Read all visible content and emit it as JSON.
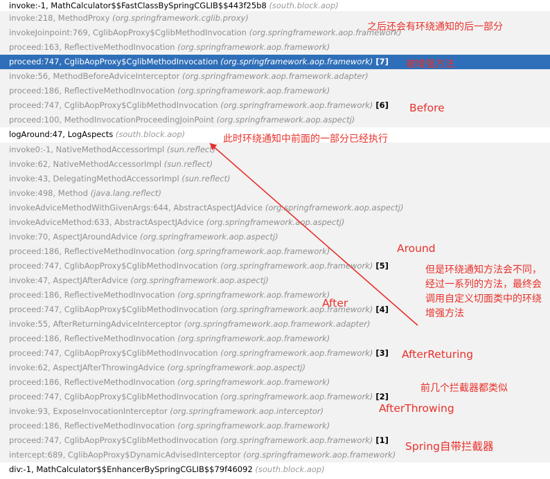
{
  "frames": [
    {
      "method": "invoke:-1, MathCalculator$$FastClassBySpringCGLIB$$443f25b8",
      "pkg": "(south.block.aop)",
      "kind": "user",
      "tag": ""
    },
    {
      "method": "invoke:218, MethodProxy",
      "pkg": "(org.springframework.cglib.proxy)",
      "kind": "lib",
      "tag": ""
    },
    {
      "method": "invokeJoinpoint:769, CglibAopProxy$CglibMethodInvocation",
      "pkg": "(org.springframework.aop.framework)",
      "kind": "lib",
      "tag": ""
    },
    {
      "method": "proceed:163, ReflectiveMethodInvocation",
      "pkg": "(org.springframework.aop.framework)",
      "kind": "lib",
      "tag": ""
    },
    {
      "method": "proceed:747, CglibAopProxy$CglibMethodInvocation",
      "pkg": "(org.springframework.aop.framework)",
      "kind": "sel",
      "tag": "[7]"
    },
    {
      "method": "invoke:56, MethodBeforeAdviceInterceptor",
      "pkg": "(org.springframework.aop.framework.adapter)",
      "kind": "lib",
      "tag": ""
    },
    {
      "method": "proceed:186, ReflectiveMethodInvocation",
      "pkg": "(org.springframework.aop.framework)",
      "kind": "lib",
      "tag": ""
    },
    {
      "method": "proceed:747, CglibAopProxy$CglibMethodInvocation",
      "pkg": "(org.springframework.aop.framework)",
      "kind": "lib",
      "tag": "[6]"
    },
    {
      "method": "proceed:100, MethodInvocationProceedingJoinPoint",
      "pkg": "(org.springframework.aop.aspectj)",
      "kind": "lib",
      "tag": ""
    },
    {
      "method": "logAround:47, LogAspects",
      "pkg": "(south.block.aop)",
      "kind": "user",
      "tag": ""
    },
    {
      "method": "invoke0:-1, NativeMethodAccessorImpl",
      "pkg": "(sun.reflect)",
      "kind": "lib",
      "tag": ""
    },
    {
      "method": "invoke:62, NativeMethodAccessorImpl",
      "pkg": "(sun.reflect)",
      "kind": "lib",
      "tag": ""
    },
    {
      "method": "invoke:43, DelegatingMethodAccessorImpl",
      "pkg": "(sun.reflect)",
      "kind": "lib",
      "tag": ""
    },
    {
      "method": "invoke:498, Method",
      "pkg": "(java.lang.reflect)",
      "kind": "lib",
      "tag": ""
    },
    {
      "method": "invokeAdviceMethodWithGivenArgs:644, AbstractAspectJAdvice",
      "pkg": "(org.springframework.aop.aspectj)",
      "kind": "lib",
      "tag": ""
    },
    {
      "method": "invokeAdviceMethod:633, AbstractAspectJAdvice",
      "pkg": "(org.springframework.aop.aspectj)",
      "kind": "lib",
      "tag": ""
    },
    {
      "method": "invoke:70, AspectJAroundAdvice",
      "pkg": "(org.springframework.aop.aspectj)",
      "kind": "lib",
      "tag": ""
    },
    {
      "method": "proceed:186, ReflectiveMethodInvocation",
      "pkg": "(org.springframework.aop.framework)",
      "kind": "lib",
      "tag": ""
    },
    {
      "method": "proceed:747, CglibAopProxy$CglibMethodInvocation",
      "pkg": "(org.springframework.aop.framework)",
      "kind": "lib",
      "tag": "[5]"
    },
    {
      "method": "invoke:47, AspectJAfterAdvice",
      "pkg": "(org.springframework.aop.aspectj)",
      "kind": "lib",
      "tag": ""
    },
    {
      "method": "proceed:186, ReflectiveMethodInvocation",
      "pkg": "(org.springframework.aop.framework)",
      "kind": "lib",
      "tag": ""
    },
    {
      "method": "proceed:747, CglibAopProxy$CglibMethodInvocation",
      "pkg": "(org.springframework.aop.framework)",
      "kind": "lib",
      "tag": "[4]"
    },
    {
      "method": "invoke:55, AfterReturningAdviceInterceptor",
      "pkg": "(org.springframework.aop.framework.adapter)",
      "kind": "lib",
      "tag": ""
    },
    {
      "method": "proceed:186, ReflectiveMethodInvocation",
      "pkg": "(org.springframework.aop.framework)",
      "kind": "lib",
      "tag": ""
    },
    {
      "method": "proceed:747, CglibAopProxy$CglibMethodInvocation",
      "pkg": "(org.springframework.aop.framework)",
      "kind": "lib",
      "tag": "[3]"
    },
    {
      "method": "invoke:62, AspectJAfterThrowingAdvice",
      "pkg": "(org.springframework.aop.aspectj)",
      "kind": "lib",
      "tag": ""
    },
    {
      "method": "proceed:186, ReflectiveMethodInvocation",
      "pkg": "(org.springframework.aop.framework)",
      "kind": "lib",
      "tag": ""
    },
    {
      "method": "proceed:747, CglibAopProxy$CglibMethodInvocation",
      "pkg": "(org.springframework.aop.framework)",
      "kind": "lib",
      "tag": "[2]"
    },
    {
      "method": "invoke:93, ExposeInvocationInterceptor",
      "pkg": "(org.springframework.aop.interceptor)",
      "kind": "lib",
      "tag": ""
    },
    {
      "method": "proceed:186, ReflectiveMethodInvocation",
      "pkg": "(org.springframework.aop.framework)",
      "kind": "lib",
      "tag": ""
    },
    {
      "method": "proceed:747, CglibAopProxy$CglibMethodInvocation",
      "pkg": "(org.springframework.aop.framework)",
      "kind": "lib",
      "tag": "[1]"
    },
    {
      "method": "intercept:689, CglibAopProxy$DynamicAdvisedInterceptor",
      "pkg": "(org.springframework.aop.framework)",
      "kind": "lib",
      "tag": ""
    },
    {
      "method": "div:-1, MathCalculator$$EnhancerBySpringCGLIB$$79f46092",
      "pkg": "(south.block.aop)",
      "kind": "user",
      "tag": ""
    }
  ],
  "annotations": {
    "after_around_rest": "之后还会有环绕通知的后一部分",
    "enhanced_method": "被增强方法",
    "before": "Before",
    "around_first_part": "此时环绕通知中前面的一部分已经执行",
    "around": "Around",
    "around_explain": "但是环绕通知方法会不同，经过一系列的方法，最终会调用自定义切面类中的环绕增强方法",
    "after": "After",
    "after_returning": "AfterReturing",
    "similar_interceptors": "前几个拦截器都类似",
    "after_throwing": "AfterThrowing",
    "spring_builtin": "Spring自带拦截器"
  },
  "colors": {
    "annotation": "#e8302a",
    "selection": "#2f6fb9"
  }
}
